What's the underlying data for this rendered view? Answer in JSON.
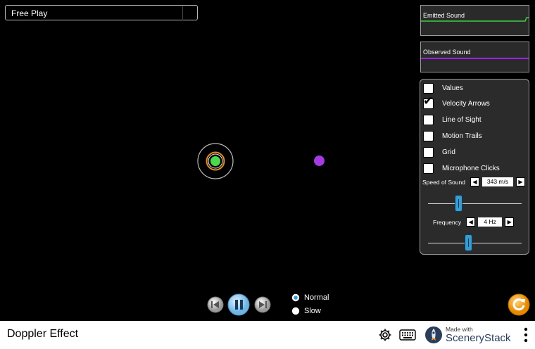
{
  "scene_selector": {
    "label": "Free Play"
  },
  "emitted_panel": {
    "title": "Emitted Sound",
    "wave_color": "#3fce3f"
  },
  "observed_panel": {
    "title": "Observed Sound",
    "wave_color": "#a020f0"
  },
  "controls": {
    "checkboxes": [
      {
        "label": "Values",
        "checked": false
      },
      {
        "label": "Velocity Arrows",
        "checked": true
      },
      {
        "label": "Line of Sight",
        "checked": false
      },
      {
        "label": "Motion Trails",
        "checked": false
      },
      {
        "label": "Grid",
        "checked": false
      },
      {
        "label": "Microphone Clicks",
        "checked": false
      }
    ],
    "speed_of_sound": {
      "label": "Speed of Sound",
      "value": "343 m/s"
    },
    "frequency": {
      "label": "Frequency",
      "value": "4 Hz"
    }
  },
  "playback": {
    "speed_options": [
      {
        "label": "Normal",
        "selected": true
      },
      {
        "label": "Slow",
        "selected": false
      }
    ]
  },
  "navbar": {
    "sim_title": "Doppler Effect",
    "made_with": "Made with",
    "brand": "SceneryStack"
  },
  "colors": {
    "source_fill": "#4cd84c",
    "source_ring": "#e08a2a",
    "observer": "#a43be0",
    "accent_blue": "#3a9bd0"
  }
}
